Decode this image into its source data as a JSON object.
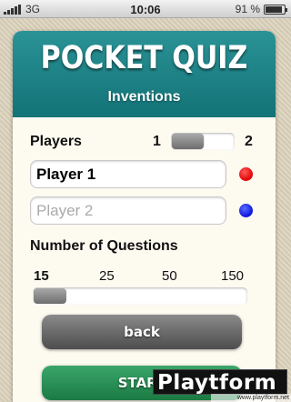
{
  "status_bar": {
    "carrier": "3G",
    "time": "10:06",
    "battery_percent": "91 %",
    "battery_level": 0.91
  },
  "header": {
    "title": "POCKET QUIZ",
    "subtitle": "Inventions"
  },
  "players": {
    "label": "Players",
    "min": "1",
    "max": "2",
    "selected_fraction": 0
  },
  "player_fields": [
    {
      "value": "Player 1",
      "color": "#e00000"
    },
    {
      "placeholder": "Player 2",
      "color": "#0a14d8"
    }
  ],
  "questions": {
    "label": "Number of Questions",
    "options": [
      "15",
      "25",
      "50",
      "150"
    ],
    "selected": "15",
    "slider_fraction": 0
  },
  "buttons": {
    "back": "back",
    "start": "START"
  },
  "watermark": {
    "logo": "Playtform",
    "url": "www.playtform.net"
  },
  "colors": {
    "header": "#1d8589",
    "back_button": "#6b6b6b",
    "start_button": "#2a8f55"
  }
}
